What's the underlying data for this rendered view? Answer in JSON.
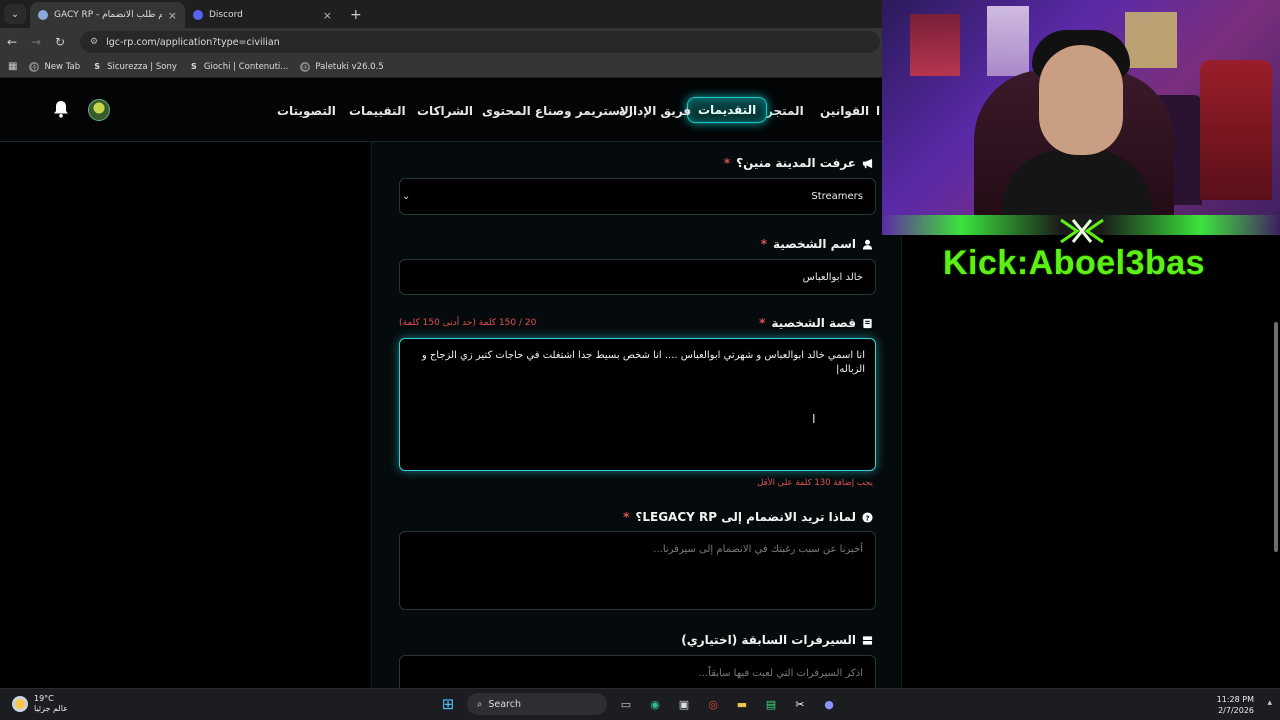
{
  "browser": {
    "tabs": [
      {
        "title": "GACY RP - تقديم طلب الانضمام",
        "active": true,
        "icon": "site-favicon"
      },
      {
        "title": "Discord",
        "active": false,
        "icon": "discord-icon"
      }
    ],
    "close_glyph": "×",
    "new_tab_glyph": "+",
    "url": "lgc-rp.com/application?type=civilian",
    "bookmarks": [
      {
        "label": "New Tab",
        "icon": "globe-icon"
      },
      {
        "label": "Sicurezza | Sony",
        "icon": "s-icon"
      },
      {
        "label": "Giochi | Contenuti...",
        "icon": "s-icon"
      },
      {
        "label": "Paletuki v26.0.5",
        "icon": "globe-icon"
      }
    ]
  },
  "site_nav": {
    "links": [
      {
        "label": "القوانين",
        "key": "rules"
      },
      {
        "label": "المتجر",
        "key": "store"
      },
      {
        "label": "التقديمات",
        "key": "applications",
        "active": true
      },
      {
        "label": "فريق الإدارة",
        "key": "admin-team"
      },
      {
        "label": "الاستريمر وصناع المحتوى",
        "key": "streamers"
      },
      {
        "label": "الشراكات",
        "key": "partners"
      },
      {
        "label": "التقييمات",
        "key": "reviews"
      },
      {
        "label": "التصويتات",
        "key": "votes"
      }
    ],
    "partial_link": "ا"
  },
  "form": {
    "city_source": {
      "label": "عرفت المدينة منين؟",
      "required": "*",
      "value": "Streamers",
      "icon": "megaphone-icon"
    },
    "character_name": {
      "label": "اسم الشخصية",
      "required": "*",
      "value": "خالد ابوالعباس",
      "icon": "user-icon"
    },
    "character_story": {
      "label": "قصة الشخصية",
      "required": "*",
      "icon": "book-icon",
      "counter": "20 / 150 كلمة (حد أدنى 150 كلمة)",
      "value": "انا اسمي خالد ابوالعباس و شهرتي ابوالعباس .... انا شخص بسيط جدا اشتغلت في حاجات كتير زي الزجاج و الزباله|",
      "hint": "يجب إضافة 130 كلمة على الأقل"
    },
    "why_join": {
      "label": "لماذا تريد الانضمام إلى LEGACY RP؟",
      "required": "*",
      "icon": "question-circle-icon",
      "placeholder": "أخبرنا عن سبب رغبتك في الانضمام إلى سيرفرنا..."
    },
    "previous_servers": {
      "label": "السيرفرات السابقة (اختياري)",
      "icon": "server-icon",
      "placeholder": "اذكر السيرفرات التي لعبت فيها سابقاً..."
    }
  },
  "stream_overlay": {
    "kick": "Kick:Aboel3bas"
  },
  "taskbar": {
    "weather_temp": "19°C",
    "weather_desc": "عالم جزئيا",
    "search_label": "Search",
    "time": "11:28 PM",
    "date": "2/7/2026"
  },
  "colors": {
    "accent": "#31d3d8",
    "required": "#e05252",
    "kick_green": "#5cf015"
  }
}
